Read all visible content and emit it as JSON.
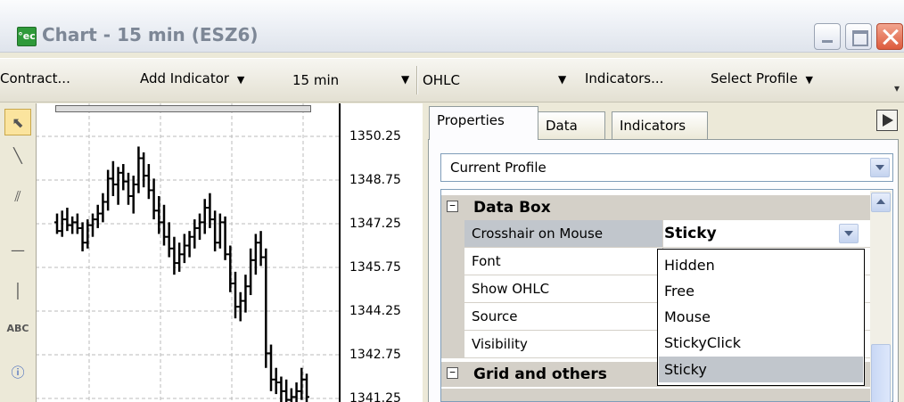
{
  "window": {
    "title": "Chart - 15 min (ESZ6)",
    "app_icon_text": "°ec"
  },
  "toolbar": {
    "contract_label": "Contract...",
    "add_indicator_label": "Add Indicator",
    "interval_value": "15 min",
    "chart_type_value": "OHLC",
    "indicators_label": "Indicators...",
    "select_profile_label": "Select Profile"
  },
  "tools": [
    "arrow-tool-icon",
    "line-tool-icon",
    "parallel-lines-tool-icon",
    "horizontal-line-tool-icon",
    "vertical-line-tool-icon",
    "text-tool-icon",
    "info-tool-icon"
  ],
  "tool_text_label": "ABC",
  "price_axis": {
    "ticks": [
      "1350.25",
      "1348.75",
      "1347.25",
      "1345.75",
      "1344.25",
      "1342.75",
      "1341.25"
    ]
  },
  "panel": {
    "tabs": [
      "Properties",
      "Data",
      "Indicators"
    ],
    "active_tab": "Properties",
    "profile_value": "Current Profile",
    "categories": [
      {
        "label": "Data Box",
        "toggle": "⊟"
      },
      {
        "label": "Grid and others",
        "toggle": "⊟"
      }
    ],
    "properties": [
      {
        "name": "Crosshair on Mouse",
        "value": "Sticky"
      },
      {
        "name": "Font",
        "value": ""
      },
      {
        "name": "Show OHLC",
        "value": ""
      },
      {
        "name": "Source",
        "value": ""
      },
      {
        "name": "Visibility",
        "value": ""
      }
    ],
    "dropdown_options": [
      "Hidden",
      "Free",
      "Mouse",
      "StickyClick",
      "Sticky"
    ],
    "dropdown_selected": "Sticky"
  },
  "colors": {
    "bars": "#000000",
    "selection": "#c1c6cc",
    "category_bg": "#d4d0c8",
    "close_button": "#dd5b3d"
  },
  "chart_data": {
    "type": "bar",
    "style": "OHLC",
    "interval": "15 min",
    "symbol": "ESZ6",
    "y_ticks": [
      1350.25,
      1348.75,
      1347.25,
      1345.75,
      1344.25,
      1342.75,
      1341.25
    ],
    "ylim": [
      1340.9,
      1351.0
    ],
    "grid": true,
    "bars": [
      {
        "o": 1347.3,
        "h": 1347.6,
        "l": 1346.9,
        "c": 1347.0
      },
      {
        "o": 1347.0,
        "h": 1347.7,
        "l": 1346.8,
        "c": 1347.4
      },
      {
        "o": 1347.4,
        "h": 1347.8,
        "l": 1347.0,
        "c": 1347.2
      },
      {
        "o": 1347.2,
        "h": 1347.5,
        "l": 1346.9,
        "c": 1347.3
      },
      {
        "o": 1347.3,
        "h": 1347.6,
        "l": 1346.9,
        "c": 1347.1
      },
      {
        "o": 1347.1,
        "h": 1347.3,
        "l": 1346.3,
        "c": 1346.6
      },
      {
        "o": 1346.6,
        "h": 1347.4,
        "l": 1346.4,
        "c": 1347.2
      },
      {
        "o": 1347.2,
        "h": 1347.6,
        "l": 1346.8,
        "c": 1347.4
      },
      {
        "o": 1347.4,
        "h": 1347.9,
        "l": 1347.1,
        "c": 1347.6
      },
      {
        "o": 1347.6,
        "h": 1348.3,
        "l": 1347.3,
        "c": 1348.0
      },
      {
        "o": 1348.0,
        "h": 1349.1,
        "l": 1347.7,
        "c": 1348.8
      },
      {
        "o": 1348.8,
        "h": 1349.4,
        "l": 1348.2,
        "c": 1348.6
      },
      {
        "o": 1348.6,
        "h": 1349.2,
        "l": 1347.9,
        "c": 1349.0
      },
      {
        "o": 1349.0,
        "h": 1349.3,
        "l": 1348.4,
        "c": 1348.7
      },
      {
        "o": 1348.7,
        "h": 1349.0,
        "l": 1347.9,
        "c": 1348.2
      },
      {
        "o": 1348.2,
        "h": 1348.9,
        "l": 1347.6,
        "c": 1348.6
      },
      {
        "o": 1348.6,
        "h": 1349.9,
        "l": 1348.3,
        "c": 1349.5
      },
      {
        "o": 1349.5,
        "h": 1349.7,
        "l": 1348.5,
        "c": 1348.9
      },
      {
        "o": 1348.9,
        "h": 1349.3,
        "l": 1348.1,
        "c": 1348.4
      },
      {
        "o": 1348.4,
        "h": 1348.8,
        "l": 1347.4,
        "c": 1347.7
      },
      {
        "o": 1347.7,
        "h": 1348.2,
        "l": 1346.9,
        "c": 1347.3
      },
      {
        "o": 1347.3,
        "h": 1347.9,
        "l": 1346.5,
        "c": 1346.8
      },
      {
        "o": 1346.8,
        "h": 1347.3,
        "l": 1346.1,
        "c": 1346.4
      },
      {
        "o": 1346.4,
        "h": 1346.8,
        "l": 1345.5,
        "c": 1345.9
      },
      {
        "o": 1345.9,
        "h": 1346.6,
        "l": 1345.6,
        "c": 1346.2
      },
      {
        "o": 1346.2,
        "h": 1346.9,
        "l": 1345.9,
        "c": 1346.5
      },
      {
        "o": 1346.5,
        "h": 1347.0,
        "l": 1346.1,
        "c": 1346.8
      },
      {
        "o": 1346.8,
        "h": 1347.4,
        "l": 1346.4,
        "c": 1347.1
      },
      {
        "o": 1347.1,
        "h": 1347.6,
        "l": 1346.7,
        "c": 1347.3
      },
      {
        "o": 1347.3,
        "h": 1348.1,
        "l": 1346.9,
        "c": 1347.8
      },
      {
        "o": 1347.8,
        "h": 1348.3,
        "l": 1347.1,
        "c": 1347.4
      },
      {
        "o": 1347.4,
        "h": 1347.7,
        "l": 1346.3,
        "c": 1346.6
      },
      {
        "o": 1346.6,
        "h": 1347.6,
        "l": 1346.4,
        "c": 1347.3
      },
      {
        "o": 1347.3,
        "h": 1347.5,
        "l": 1346.0,
        "c": 1346.2
      },
      {
        "o": 1346.2,
        "h": 1346.5,
        "l": 1344.9,
        "c": 1345.2
      },
      {
        "o": 1345.2,
        "h": 1345.6,
        "l": 1344.0,
        "c": 1344.4
      },
      {
        "o": 1344.4,
        "h": 1344.9,
        "l": 1343.9,
        "c": 1344.6
      },
      {
        "o": 1344.6,
        "h": 1345.5,
        "l": 1344.2,
        "c": 1345.1
      },
      {
        "o": 1345.1,
        "h": 1346.4,
        "l": 1344.8,
        "c": 1346.0
      },
      {
        "o": 1346.0,
        "h": 1346.9,
        "l": 1345.5,
        "c": 1346.6
      },
      {
        "o": 1346.6,
        "h": 1347.0,
        "l": 1345.8,
        "c": 1346.1
      },
      {
        "o": 1346.1,
        "h": 1346.4,
        "l": 1342.3,
        "c": 1342.8
      },
      {
        "o": 1342.8,
        "h": 1343.1,
        "l": 1341.5,
        "c": 1341.9
      },
      {
        "o": 1341.9,
        "h": 1342.3,
        "l": 1341.4,
        "c": 1341.8
      },
      {
        "o": 1341.8,
        "h": 1342.0,
        "l": 1341.1,
        "c": 1341.5
      },
      {
        "o": 1341.5,
        "h": 1341.9,
        "l": 1341.0,
        "c": 1341.2
      },
      {
        "o": 1341.2,
        "h": 1341.6,
        "l": 1340.9,
        "c": 1341.3
      },
      {
        "o": 1341.3,
        "h": 1341.8,
        "l": 1341.0,
        "c": 1341.5
      },
      {
        "o": 1341.5,
        "h": 1342.3,
        "l": 1341.2,
        "c": 1341.9
      },
      {
        "o": 1341.9,
        "h": 1342.1,
        "l": 1341.1,
        "c": 1341.3
      }
    ]
  }
}
